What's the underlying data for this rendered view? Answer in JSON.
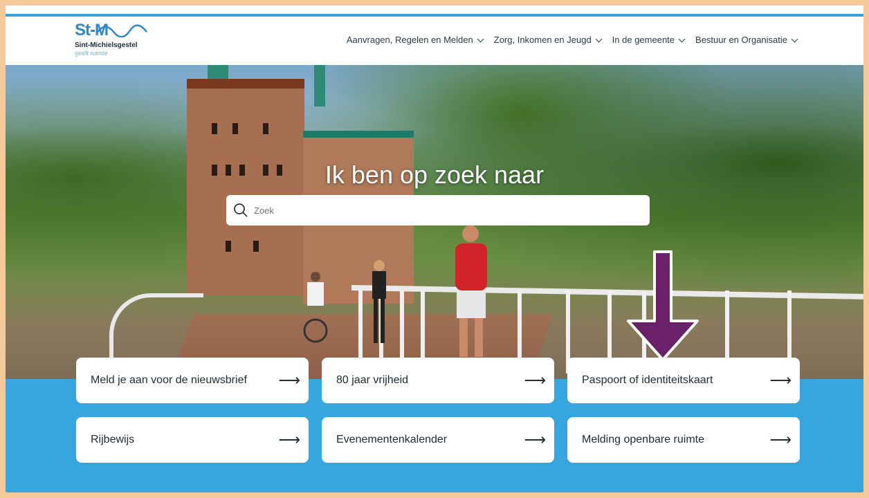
{
  "header": {
    "logo": {
      "mark": "St-M",
      "name": "Sint-Michielsgestel",
      "tagline": "geeft ruimte"
    },
    "nav": [
      {
        "label": "Aanvragen, Regelen en Melden"
      },
      {
        "label": "Zorg, Inkomen en Jeugd"
      },
      {
        "label": "In de gemeente"
      },
      {
        "label": "Bestuur en Organisatie"
      }
    ]
  },
  "hero": {
    "title": "Ik ben op zoek naar",
    "search": {
      "placeholder": "Zoek",
      "value": ""
    }
  },
  "cards": [
    {
      "label": "Meld je aan voor de nieuwsbrief"
    },
    {
      "label": "80 jaar vrijheid"
    },
    {
      "label": "Paspoort of identiteitskaart"
    },
    {
      "label": "Rijbewijs"
    },
    {
      "label": "Evenementenkalender"
    },
    {
      "label": "Melding openbare ruimte"
    }
  ],
  "colors": {
    "accent_blue": "#38a6de",
    "frame": "#f5c99a",
    "callout_arrow": "#6a2168"
  },
  "icons": {
    "search": "search-icon",
    "arrow": "arrow-right-icon",
    "chevron": "chevron-down-icon"
  }
}
